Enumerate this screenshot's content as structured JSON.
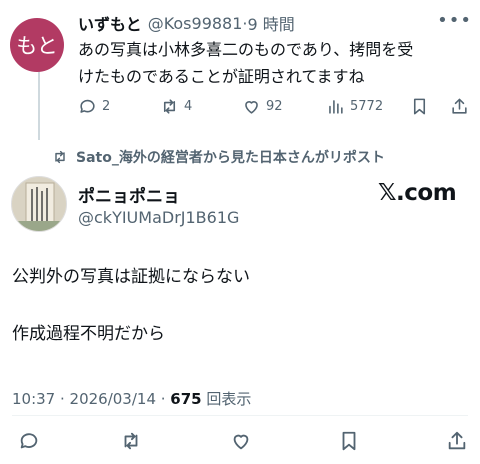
{
  "reply": {
    "avatar_text": "もと",
    "display_name": "いずもと",
    "handle": "@Kos99881",
    "separator": "·",
    "time": "9 時間",
    "text_line1": "あの写真は小林多喜二のものであり、拷問を受",
    "text_line2": "けたものであることが証明されてますね",
    "replies": "2",
    "reposts": "4",
    "likes": "92",
    "views": "5772"
  },
  "repost_banner": {
    "text": "Sato_海外の経営者から見た日本さんがリポスト"
  },
  "main": {
    "display_name": "ポニョポニョ",
    "handle": "@ckYIUMaDrJ1B61G",
    "brand": "𝕏.com",
    "line1": "公判外の写真は証拠にならない",
    "line2": "作成過程不明だから",
    "timestamp": "10:37 · 2026/03/14 · ",
    "view_count": "675",
    "view_label": " 回表示"
  },
  "colors": {
    "avatar_bg": "#b23a63",
    "muted": "#536471",
    "text": "#0f1419"
  }
}
